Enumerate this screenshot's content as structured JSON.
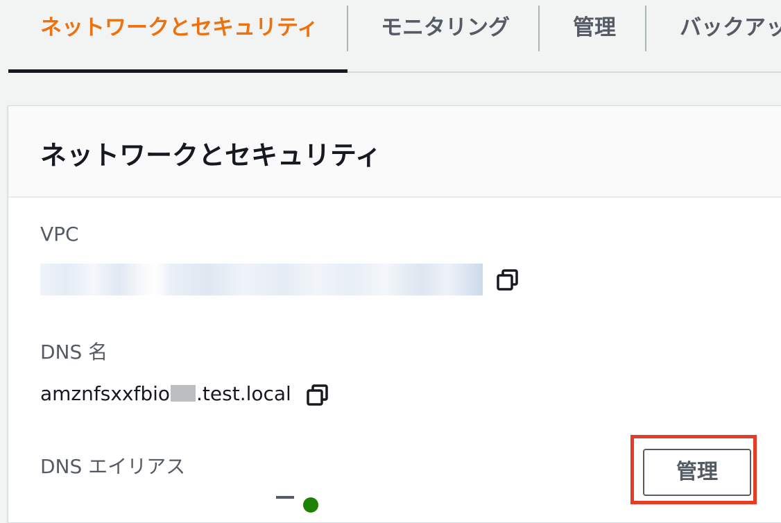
{
  "tabs": [
    {
      "label": "ネットワークとセキュリティ",
      "active": true
    },
    {
      "label": "モニタリング",
      "active": false
    },
    {
      "label": "管理",
      "active": false
    },
    {
      "label": "バックアッ",
      "active": false
    }
  ],
  "panel": {
    "title": "ネットワークとセキュリティ",
    "vpc": {
      "label": "VPC"
    },
    "dns_name": {
      "label": "DNS 名",
      "value_prefix": "amznfsxxfbio",
      "value_suffix": ".test.local"
    },
    "dns_alias": {
      "label": "DNS エイリアス",
      "manage_label": "管理"
    }
  },
  "colors": {
    "accent": "#ec7211",
    "highlight": "#e63b25",
    "status_green": "#1d8102"
  },
  "icons": [
    "copy-icon",
    "copy-icon"
  ]
}
